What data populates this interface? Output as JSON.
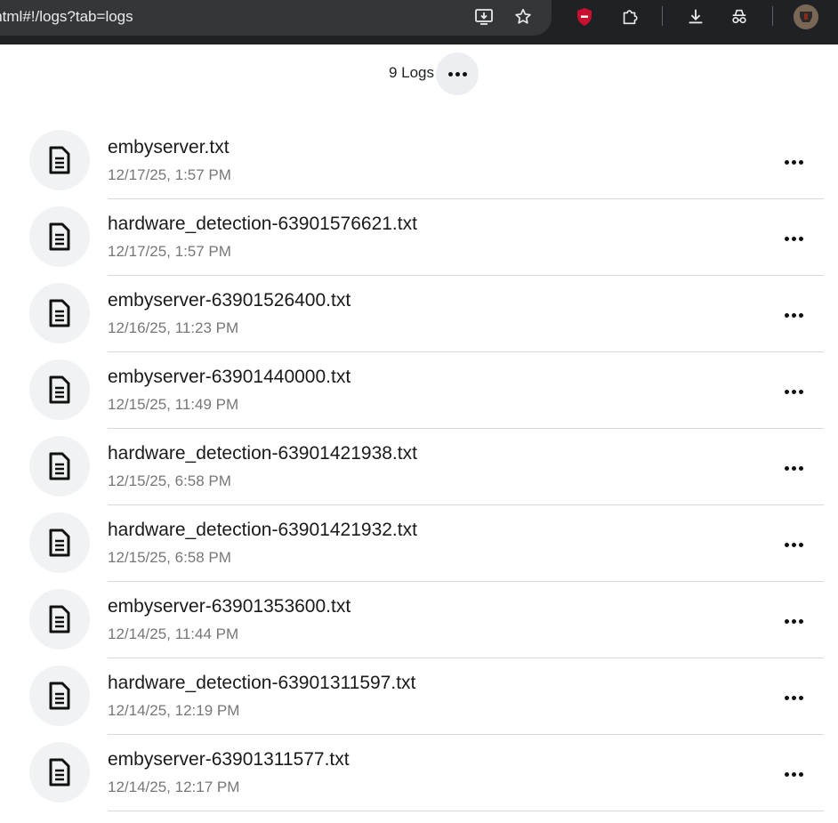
{
  "browser": {
    "url": "x.html#!/logs?tab=logs",
    "icons": [
      "install-app-icon",
      "bookmark-star-icon",
      "shield-extension-icon",
      "extensions-puzzle-icon",
      "downloads-icon",
      "incognito-icon",
      "profile-avatar"
    ],
    "colors": {
      "toolbar": "#202124",
      "omnibox": "#35363a",
      "shield": "#c8102e"
    }
  },
  "header": {
    "count_label": "9 Logs",
    "menu_icon": "more-horizontal-icon"
  },
  "logs": [
    {
      "name": "embyserver.txt",
      "date": "12/17/25, 1:57 PM"
    },
    {
      "name": "hardware_detection-63901576621.txt",
      "date": "12/17/25, 1:57 PM"
    },
    {
      "name": "embyserver-63901526400.txt",
      "date": "12/16/25, 11:23 PM"
    },
    {
      "name": "embyserver-63901440000.txt",
      "date": "12/15/25, 11:49 PM"
    },
    {
      "name": "hardware_detection-63901421938.txt",
      "date": "12/15/25, 6:58 PM"
    },
    {
      "name": "hardware_detection-63901421932.txt",
      "date": "12/15/25, 6:58 PM"
    },
    {
      "name": "embyserver-63901353600.txt",
      "date": "12/14/25, 11:44 PM"
    },
    {
      "name": "hardware_detection-63901311597.txt",
      "date": "12/14/25, 12:19 PM"
    },
    {
      "name": "embyserver-63901311577.txt",
      "date": "12/14/25, 12:17 PM"
    }
  ]
}
